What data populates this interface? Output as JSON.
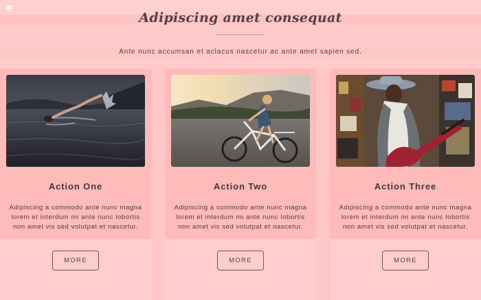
{
  "header": {
    "menu_icon": "hamburger-menu-icon",
    "title": "Adipiscing amet consequat",
    "subtitle": "Ante nunc accumsan et aclacus nascetur ac ante amet sapien sed."
  },
  "cards": [
    {
      "image": "swimmer-in-lake-photo",
      "title": "Action One",
      "text": "Adipiscing a commodo ante nunc magna lorem et interdum mi ante nunc lobortis non amet vis sed volutpat et nascetur.",
      "button_label": "MORE"
    },
    {
      "image": "woman-on-bicycle-photo",
      "title": "Action Two",
      "text": "Adipiscing a commodo ante nunc magna lorem et interdum mi ante nunc lobortis non amet vis sed volutpat et nascetur.",
      "button_label": "MORE"
    },
    {
      "image": "woman-with-guitar-photo",
      "title": "Action Three",
      "text": "Adipiscing a commodo ante nunc magna lorem et interdum mi ante nunc lobortis non amet vis sed volutpat et nascetur.",
      "button_label": "MORE"
    }
  ],
  "colors": {
    "background": "#ffc7c7",
    "card_top": "#ffbaba",
    "card_bottom": "#ffcdcd",
    "text": "#4a4045",
    "button_border": "#6b5a5e"
  }
}
